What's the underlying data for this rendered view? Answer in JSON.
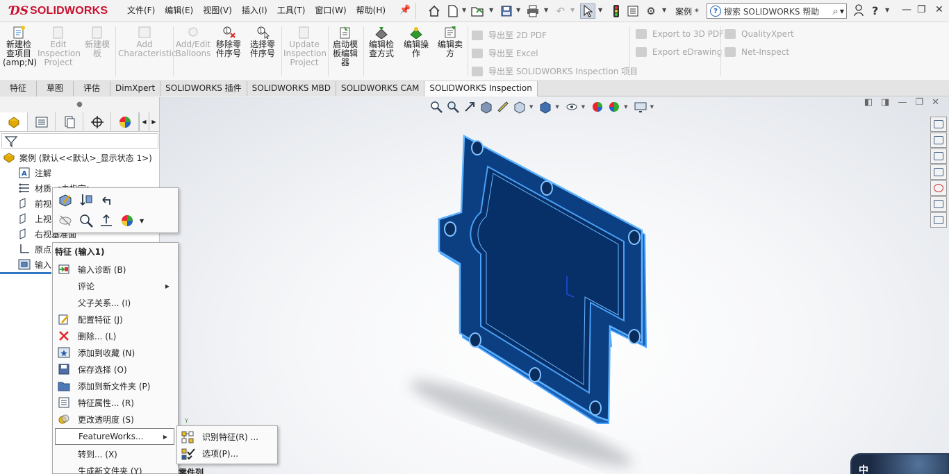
{
  "app": {
    "brand": "SOLIDWORKS"
  },
  "menu": [
    "文件(F)",
    "编辑(E)",
    "视图(V)",
    "插入(I)",
    "工具(T)",
    "窗口(W)",
    "帮助(H)"
  ],
  "quickbar": {
    "doc_name": "案例 *",
    "search_placeholder": "搜索 SOLIDWORKS 帮助"
  },
  "ribbon": {
    "buttons": [
      {
        "label": "新建检查项目(amp;N)",
        "disabled": false,
        "icon": "new-inspection-icon"
      },
      {
        "label": "Edit Inspection Project",
        "disabled": true,
        "icon": "edit-inspection-icon"
      },
      {
        "label": "新建模板",
        "disabled": true,
        "icon": "new-template-icon"
      },
      {
        "label": "Add Characteristic",
        "disabled": true,
        "icon": "add-characteristic-icon"
      },
      {
        "label": "Add/Edit Balloons",
        "disabled": true,
        "icon": "balloons-icon"
      },
      {
        "label": "移除零件序号",
        "disabled": false,
        "icon": "remove-balloon-icon"
      },
      {
        "label": "选择零件序号",
        "disabled": false,
        "icon": "select-balloon-icon"
      },
      {
        "label": "Update Inspection Project",
        "disabled": true,
        "icon": "update-project-icon"
      },
      {
        "label": "启动模板编辑器",
        "disabled": false,
        "icon": "template-editor-icon"
      },
      {
        "label": "编辑检查方式",
        "disabled": false,
        "icon": "edit-method-icon"
      },
      {
        "label": "编辑操作",
        "disabled": false,
        "icon": "edit-operation-icon"
      },
      {
        "label": "编辑卖方",
        "disabled": false,
        "icon": "edit-vendor-icon"
      }
    ],
    "export": [
      "导出至 2D PDF",
      "导出至 Excel",
      "导出至 SOLIDWORKS Inspection 项目",
      "Export to 3D PDF",
      "Export eDrawing",
      "QualityXpert",
      "Net-Inspect"
    ]
  },
  "tabs": [
    "特征",
    "草图",
    "评估",
    "DimXpert",
    "SOLIDWORKS 插件",
    "SOLIDWORKS MBD",
    "SOLIDWORKS CAM",
    "SOLIDWORKS Inspection"
  ],
  "active_tab": "SOLIDWORKS Inspection",
  "tree": {
    "root": "案例  (默认<<默认>_显示状态 1>)",
    "items": [
      "注解",
      "材质 <未指定>",
      "前视基准面",
      "上视基准面",
      "右视基准面",
      "原点",
      "输入1"
    ]
  },
  "context_menu": {
    "title": "特征 (输入1)",
    "items": [
      {
        "label": "输入诊断 (B)",
        "icon": "diagnose-icon"
      },
      {
        "label": "评论",
        "submenu": true
      },
      {
        "label": "父子关系... (I)"
      },
      {
        "label": "配置特征 (J)",
        "icon": "config-feature-icon"
      },
      {
        "label": "删除... (L)",
        "icon": "delete-icon"
      },
      {
        "label": "添加到收藏 (N)",
        "icon": "favorite-icon"
      },
      {
        "label": "保存选择 (O)",
        "icon": "save-selection-icon"
      },
      {
        "label": "添加到新文件夹 (P)",
        "icon": "folder-icon"
      },
      {
        "label": "特征属性... (R)",
        "icon": "properties-icon"
      },
      {
        "label": "更改透明度 (S)",
        "icon": "transparency-icon"
      },
      {
        "label": "FeatureWorks...",
        "submenu": true,
        "highlight": true
      },
      {
        "label": "转到... (X)"
      },
      {
        "label": "生成新文件夹 (Y)"
      }
    ]
  },
  "submenu": {
    "items": [
      "识别特征(R) ...",
      "选项(P)..."
    ]
  },
  "partial_text": "零件列",
  "weather_char": "中",
  "colors": {
    "part_blue": "#0a3a7a",
    "part_edge": "#3a8fe8",
    "accent": "#2f77c3"
  }
}
